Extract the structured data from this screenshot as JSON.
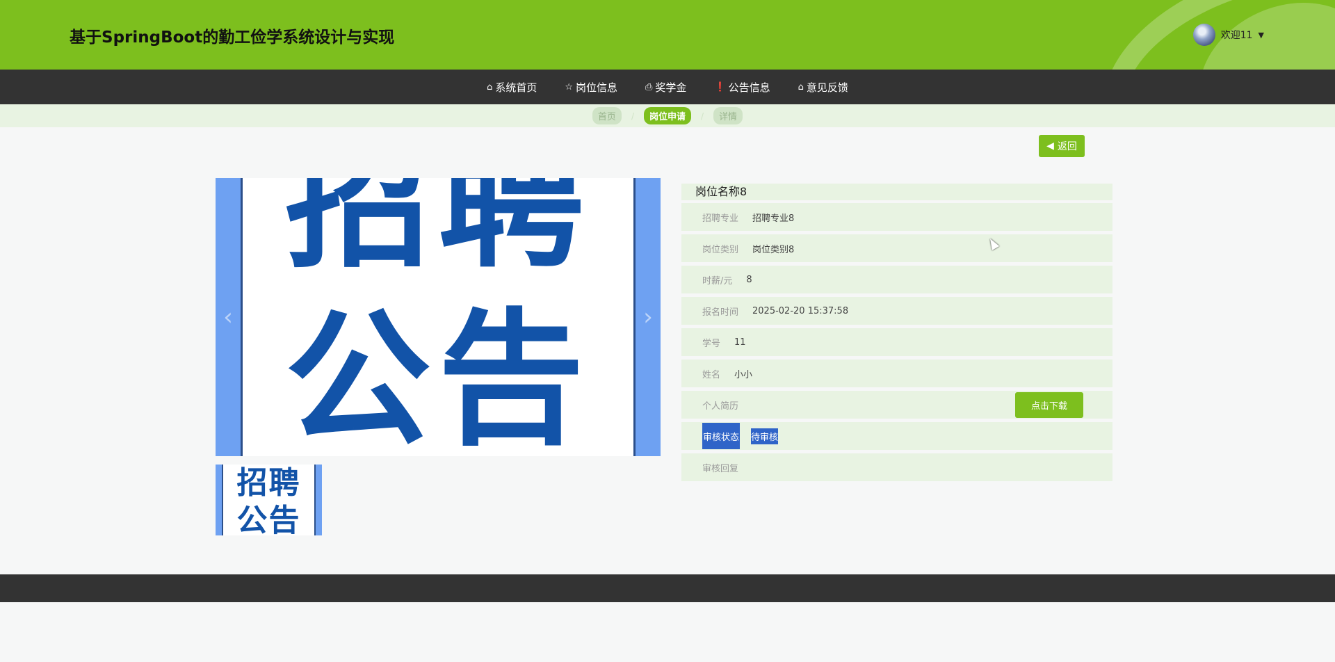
{
  "header": {
    "title": "基于SpringBoot的勤工俭学系统设计与实现",
    "welcome": "欢迎11",
    "caret_icon": "caret-down-icon"
  },
  "nav": {
    "items": [
      {
        "label": "系统首页",
        "icon": "home-icon"
      },
      {
        "label": "岗位信息",
        "icon": "star-icon"
      },
      {
        "label": "奖学金",
        "icon": "bag-icon"
      },
      {
        "label": "公告信息",
        "icon": "alert-icon"
      },
      {
        "label": "意见反馈",
        "icon": "home-icon"
      }
    ]
  },
  "breadcrumb": {
    "items": [
      "首页",
      "岗位申请",
      "详情"
    ],
    "active_index": 1
  },
  "back_button": {
    "label": "返回"
  },
  "carousel": {
    "poster_line1": "招聘",
    "poster_line2": "公告",
    "thumb_line1": "招聘",
    "thumb_line2": "公告"
  },
  "detail": {
    "title": "岗位名称8",
    "rows": [
      {
        "label": "招聘专业",
        "value": "招聘专业8"
      },
      {
        "label": "岗位类别",
        "value": "岗位类别8"
      },
      {
        "label": "时薪/元",
        "value": "8"
      },
      {
        "label": "报名时间",
        "value": "2025-02-20 15:37:58"
      },
      {
        "label": "学号",
        "value": "11"
      },
      {
        "label": "姓名",
        "value": "小小"
      }
    ],
    "resume_label": "个人简历",
    "download_label": "点击下载",
    "status_label": "审核状态",
    "status_value": "待审核",
    "reply_label": "审核回复",
    "reply_value": ""
  },
  "colors": {
    "brand_green": "#7dbf1e",
    "nav_dark": "#333333",
    "row_bg": "#e8f3e2",
    "selection_blue": "#2f64c8"
  }
}
